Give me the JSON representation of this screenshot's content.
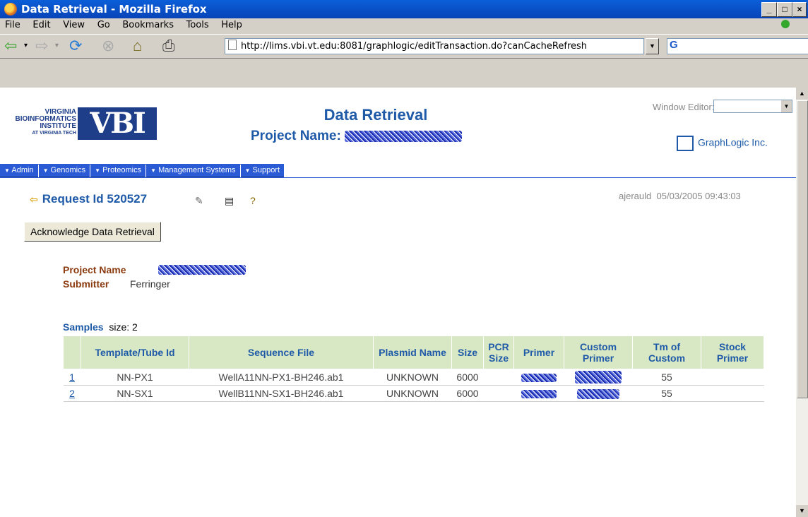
{
  "window": {
    "title": "Data Retrieval - Mozilla Firefox"
  },
  "menubar": [
    "File",
    "Edit",
    "View",
    "Go",
    "Bookmarks",
    "Tools",
    "Help"
  ],
  "navbar": {
    "url": "http://lims.vbi.vt.edu:8081/graphlogic/editTransaction.do?canCacheRefresh"
  },
  "header": {
    "logo_lines": [
      "VIRGINIA",
      "BIOINFORMATICS",
      "INSTITUTE",
      "AT VIRGINIA TECH"
    ],
    "logo_mark": "VBI",
    "title": "Data Retrieval",
    "project_label": "Project Name:",
    "window_editor_label": "Window Editor:",
    "company": "GraphLogic Inc."
  },
  "app_menu": [
    "Admin",
    "Genomics",
    "Proteomics",
    "Management Systems",
    "Support"
  ],
  "request": {
    "label": "Request Id 520527",
    "user": "ajerauld",
    "datetime": "05/03/2005 09:43:03"
  },
  "ack_button": "Acknowledge Data Retrieval",
  "info": {
    "project_name_label": "Project Name",
    "submitter_label": "Submitter",
    "submitter_value": "Ferringer"
  },
  "samples": {
    "label": "Samples",
    "size_text": "size: 2",
    "columns": [
      "",
      "Template/Tube Id",
      "Sequence File",
      "Plasmid Name",
      "Size",
      "PCR Size",
      "Primer",
      "Custom Primer",
      "Tm of Custom",
      "Stock Primer"
    ],
    "rows": [
      {
        "num": "1",
        "template": "NN-PX1",
        "file": "WellA11NN-PX1-BH246.ab1",
        "plasmid": "UNKNOWN",
        "size": "6000",
        "tm": "55"
      },
      {
        "num": "2",
        "template": "NN-SX1",
        "file": "WellB11NN-SX1-BH246.ab1",
        "plasmid": "UNKNOWN",
        "size": "6000",
        "tm": "55"
      }
    ]
  }
}
